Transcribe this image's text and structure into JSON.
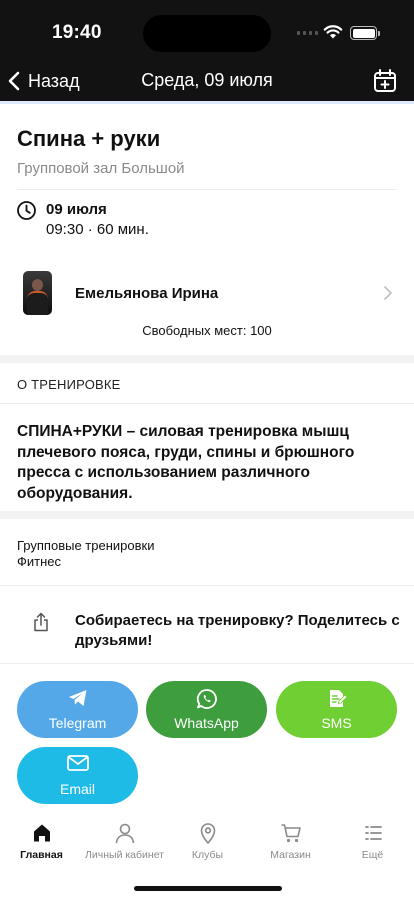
{
  "status_bar": {
    "time": "19:40"
  },
  "nav": {
    "back_label": "Назад",
    "title": "Среда, 09 июля",
    "calendar_icon": "calendar-plus-icon"
  },
  "class": {
    "title": "Спина + руки",
    "location": "Групповой зал Большой",
    "date": "09 июля",
    "time": "09:30 · 60 мин.",
    "trainer": "Емельянова Ирина",
    "free_seats": "Свободных мест: 100"
  },
  "about": {
    "heading": "О ТРЕНИРОВКЕ",
    "description": "СПИНА+РУКИ – силовая тренировка мышц плечевого пояса, груди, спины и брюшного пресса с использованием различного оборудования.",
    "tags": [
      "Групповые тренировки",
      "Фитнес"
    ]
  },
  "share": {
    "text": "Собираетесь на тренировку? Поделитесь с друзьями!",
    "buttons": [
      {
        "label": "Telegram",
        "icon": "telegram-icon",
        "color": "#55a8e8"
      },
      {
        "label": "WhatsApp",
        "icon": "whatsapp-icon",
        "color": "#3e9d3d"
      },
      {
        "label": "SMS",
        "icon": "sms-icon",
        "color": "#6fcf33"
      },
      {
        "label": "Email",
        "icon": "mail-icon",
        "color": "#1ebbe6"
      }
    ]
  },
  "tabbar": {
    "items": [
      {
        "label": "Главная",
        "icon": "home-icon",
        "active": true
      },
      {
        "label": "Личный кабинет",
        "icon": "person-icon",
        "active": false
      },
      {
        "label": "Клубы",
        "icon": "location-pin-icon",
        "active": false
      },
      {
        "label": "Магазин",
        "icon": "cart-icon",
        "active": false
      },
      {
        "label": "Ещё",
        "icon": "more-list-icon",
        "active": false
      }
    ]
  }
}
